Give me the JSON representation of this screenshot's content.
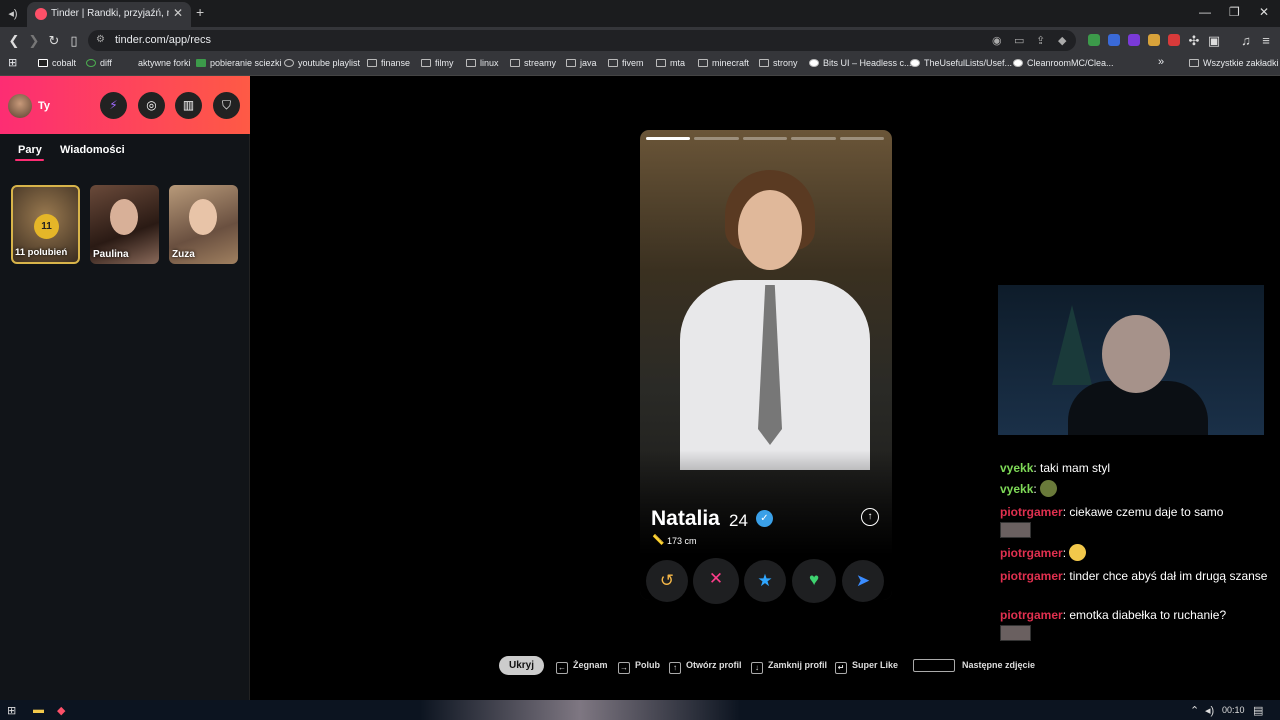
{
  "browser": {
    "tab_title": "Tinder | Randki, przyjaźń, nowe z",
    "url": "tinder.com/app/recs",
    "bookmarks": [
      "cobalt",
      "diff",
      "aktywne forki",
      "pobieranie sciezki",
      "youtube playlist",
      "finanse",
      "filmy",
      "linux",
      "streamy",
      "java",
      "fivem",
      "mta",
      "minecraft",
      "strony",
      "Bits UI – Headless c...",
      "TheUsefulLists/Usef...",
      "CleanroomMC/Clea..."
    ],
    "bookmarks_overflow": "»",
    "all_bookmarks": "Wszystkie zakładki"
  },
  "sidebar": {
    "user_name": "Ty",
    "tabs": [
      "Pary",
      "Wiadomości"
    ],
    "likes": {
      "count": "11",
      "label": "11 polubień"
    },
    "matches": [
      "Paulina",
      "Zuza"
    ]
  },
  "profile": {
    "name": "Natalia",
    "age": "24",
    "height": "173 cm",
    "photo_count": 5,
    "active_photo": 1
  },
  "actions": [
    "rewind",
    "nope",
    "super-like",
    "like",
    "boost"
  ],
  "shortcuts": {
    "hide": "Ukryj",
    "items": [
      "Żegnam",
      "Polub",
      "Otwórz profil",
      "Zamknij profil",
      "Super Like",
      "Następne zdjęcie"
    ]
  },
  "chat": {
    "messages": [
      {
        "user": "vyekk",
        "text": "taki mam styl",
        "color": "#7ed957"
      },
      {
        "user": "vyekk",
        "text": "",
        "color": "#7ed957"
      },
      {
        "user": "piotrgamer",
        "text": "ciekawe czemu daje to samo",
        "color": "#e0304f"
      },
      {
        "user": "piotrgamer",
        "text": "",
        "color": "#e0304f"
      },
      {
        "user": "piotrgamer",
        "text": "tinder chce abyś dał im drugą szanse",
        "color": "#e0304f"
      },
      {
        "user": "piotrgamer",
        "text": "emotka diabełka to ruchanie?",
        "color": "#e0304f"
      }
    ]
  },
  "taskbar": {
    "clock": "00:10"
  },
  "colors": {
    "tinder_gradient_start": "#fd2d73",
    "tinder_gradient_end": "#fe5a45",
    "gold": "#e5b628"
  }
}
